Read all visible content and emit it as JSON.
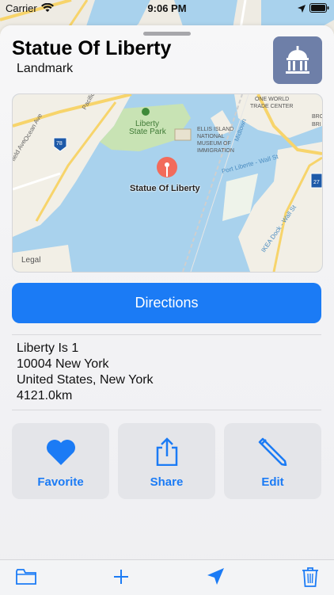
{
  "status_bar": {
    "carrier": "Carrier",
    "time": "9:06 PM"
  },
  "place": {
    "title": "Statue Of Liberty",
    "subtitle": "Landmark",
    "category_icon": "landmark-building-icon"
  },
  "map": {
    "pin_label": "Statue Of Liberty",
    "legal": "Legal",
    "labels": {
      "park": "Liberty State Park",
      "ellis1": "ELLIS ISLAND",
      "ellis2": "NATIONAL",
      "ellis3": "MUSEUM OF",
      "ellis4": "IMMIGRATION",
      "wtc1": "ONE WORLD",
      "wtc2": "TRADE CENTER",
      "pacific": "Pacific",
      "ocean": "Ocean Ave",
      "field": "field Ave",
      "i78": "78",
      "port": "Port Liberte - Wall St",
      "ikea": "IKEA Dock - Wall St",
      "midtown": "Midtown",
      "st": "St",
      "bro": "BRO",
      "bri": "BRI",
      "i27": "27"
    },
    "colors": {
      "water": "#a9d2ed",
      "land": "#f2efe6",
      "park": "#c8e3b4",
      "road": "#f7d46b"
    }
  },
  "directions_label": "Directions",
  "address": {
    "line1": "Liberty Is 1",
    "line2": "10004 New York",
    "line3": "United States, New York",
    "distance": "4121.0km"
  },
  "actions": {
    "favorite": "Favorite",
    "share": "Share",
    "edit": "Edit"
  },
  "toolbar": {
    "folder_icon": "folder-icon",
    "add_icon": "plus-icon",
    "location_icon": "location-arrow-icon",
    "trash_icon": "trash-icon"
  },
  "accent_color": "#1b7bf5"
}
